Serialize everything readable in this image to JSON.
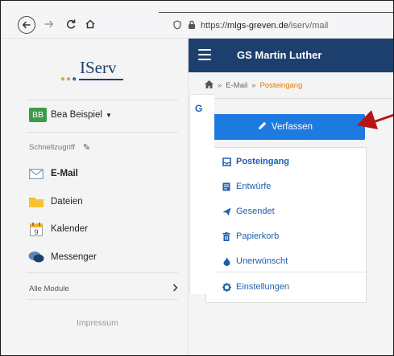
{
  "browser": {
    "url_host": "mlgs-greven.de",
    "url_prefix": "https://",
    "url_path": "/iserv/mail"
  },
  "sidebar": {
    "logo_text": "IServ",
    "user": {
      "initials": "BB",
      "name": "Bea Beispiel"
    },
    "quick_access_label": "Schnellzugriff",
    "items": [
      {
        "label": "E-Mail",
        "icon": "envelope-icon"
      },
      {
        "label": "Dateien",
        "icon": "folder-icon"
      },
      {
        "label": "Kalender",
        "icon": "calendar-icon",
        "calendar_day": "9"
      },
      {
        "label": "Messenger",
        "icon": "chat-icon"
      }
    ],
    "all_modules_label": "Alle Module",
    "impressum_label": "Impressum"
  },
  "header": {
    "title": "GS Martin Luther"
  },
  "breadcrumb": {
    "mail": "E-Mail",
    "current": "Posteingang"
  },
  "compose_label": "Verfassen",
  "folders": [
    {
      "label": "Posteingang",
      "icon": "inbox-icon"
    },
    {
      "label": "Entwürfe",
      "icon": "draft-icon"
    },
    {
      "label": "Gesendet",
      "icon": "send-icon"
    },
    {
      "label": "Papierkorb",
      "icon": "trash-icon"
    },
    {
      "label": "Unerwünscht",
      "icon": "fire-icon"
    }
  ],
  "settings_label": "Einstellungen",
  "right_panel_letter": "G",
  "colors": {
    "header": "#1d3f6e",
    "compose": "#1d7adf",
    "link": "#1d5fae",
    "active_breadcrumb": "#e07b00",
    "arrow": "#b81414"
  }
}
